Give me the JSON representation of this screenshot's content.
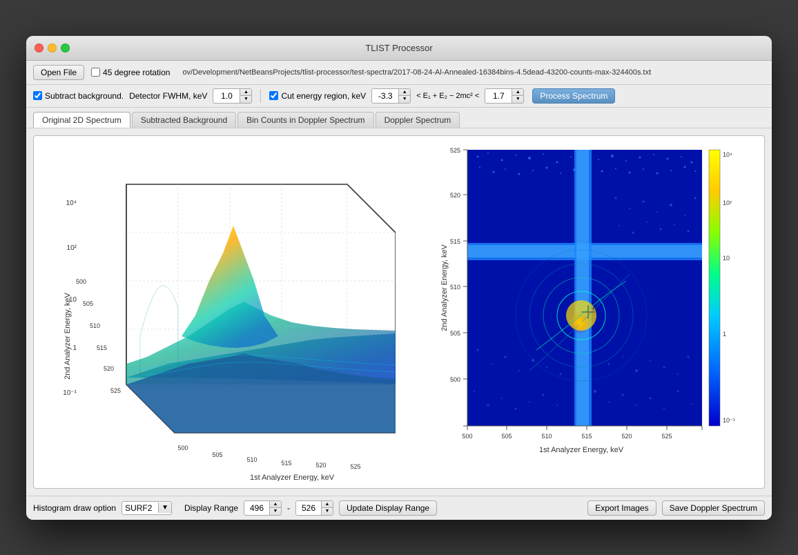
{
  "window": {
    "title": "TLIST Processor"
  },
  "toolbar": {
    "open_file": "Open File",
    "rotation_label": "45 degree rotation",
    "filepath": "ov/Development/NetBeansProjects/tlist-processor/test-spectra/2017-08-24-Al-Annealed-16384bins-4.5dead-43200-counts-max-324400s.txt"
  },
  "options": {
    "subtract_background": "Subtract background.",
    "detector_fwhm_label": "Detector FWHM, keV",
    "detector_fwhm_value": "1.0",
    "cut_energy_label": "Cut energy region, keV",
    "cut_energy_min": "-3.3",
    "cut_energy_formula": "< E₁ + E₂ − 2mc² <",
    "cut_energy_max": "1.7",
    "process_spectrum": "Process Spectrum"
  },
  "tabs": [
    {
      "label": "Original 2D Spectrum",
      "active": true
    },
    {
      "label": "Subtracted Background",
      "active": false
    },
    {
      "label": "Bin Counts in Doppler Spectrum",
      "active": false
    },
    {
      "label": "Doppler Spectrum",
      "active": false
    }
  ],
  "chart_3d": {
    "y_label": "10⁴",
    "y_label2": "10²",
    "y_label3": "10",
    "y_label4": "1",
    "y_label5": "10⁻¹",
    "x_axis_label": "1st Analyzer Energy, keV",
    "y_axis_label": "2nd Analyzer Energy, keV",
    "x_ticks": [
      "500",
      "505",
      "510",
      "515",
      "520",
      "525"
    ],
    "y_ticks": [
      "500",
      "505",
      "510",
      "515",
      "520",
      "525"
    ]
  },
  "chart_2d": {
    "x_axis_label": "1st Analyzer Energy, keV",
    "y_axis_label": "2nd Analyzer Energy, keV",
    "x_ticks": [
      "500",
      "505",
      "510",
      "515",
      "520",
      "525"
    ],
    "y_ticks": [
      "500",
      "505",
      "510",
      "515",
      "520",
      "525"
    ],
    "colorbar_labels": [
      "10⁴",
      "10²",
      "10",
      "1",
      "10⁻¹"
    ]
  },
  "bottom_bar": {
    "histogram_label": "Histogram draw option",
    "histogram_value": "SURF2",
    "display_range_label": "Display Range",
    "range_min": "496",
    "range_max": "526",
    "update_button": "Update Display Range",
    "export_button": "Export Images",
    "save_button": "Save Doppler Spectrum"
  }
}
